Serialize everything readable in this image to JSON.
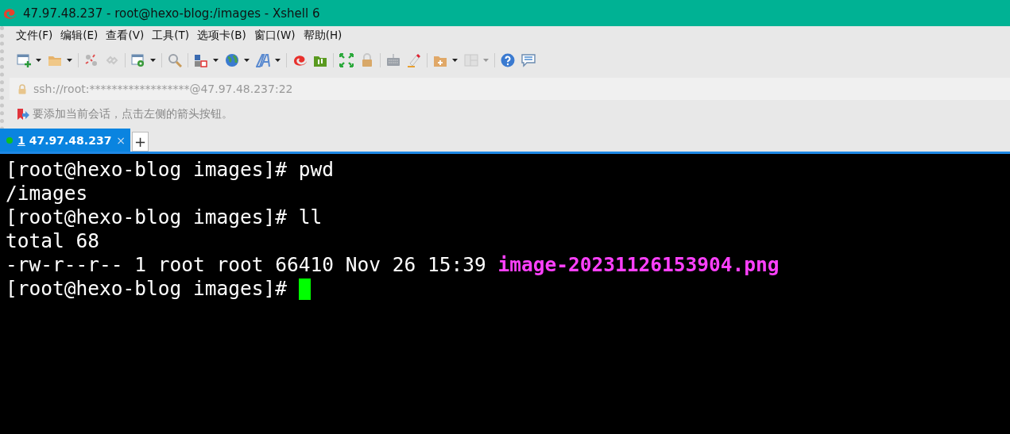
{
  "window": {
    "title": "47.97.48.237 - root@hexo-blog:/images - Xshell 6"
  },
  "menu": [
    {
      "label": "文件(F)"
    },
    {
      "label": "编辑(E)"
    },
    {
      "label": "查看(V)"
    },
    {
      "label": "工具(T)"
    },
    {
      "label": "选项卡(B)"
    },
    {
      "label": "窗口(W)"
    },
    {
      "label": "帮助(H)"
    }
  ],
  "address_bar": {
    "value": "ssh://root:******************@47.97.48.237:22"
  },
  "hint": "要添加当前会话，点击左侧的箭头按钮。",
  "tabs": [
    {
      "number": "1",
      "title": "47.97.48.237",
      "selected": true,
      "connected": true,
      "close": "×"
    }
  ],
  "new_tab": "+",
  "terminal": {
    "lines": [
      [
        {
          "kind": "text",
          "text": "[root@hexo-blog images]# pwd"
        }
      ],
      [
        {
          "kind": "text",
          "text": "/images"
        }
      ],
      [
        {
          "kind": "text",
          "text": "[root@hexo-blog images]# ll"
        }
      ],
      [
        {
          "kind": "text",
          "text": "total 68"
        }
      ],
      [
        {
          "kind": "text",
          "text": "-rw-r--r-- 1 root root 66410 Nov 26 15:39 "
        },
        {
          "kind": "file",
          "text": "image-20231126153904.png"
        }
      ],
      [
        {
          "kind": "text",
          "text": "[root@hexo-blog images]# "
        },
        {
          "kind": "cursor"
        }
      ]
    ]
  }
}
